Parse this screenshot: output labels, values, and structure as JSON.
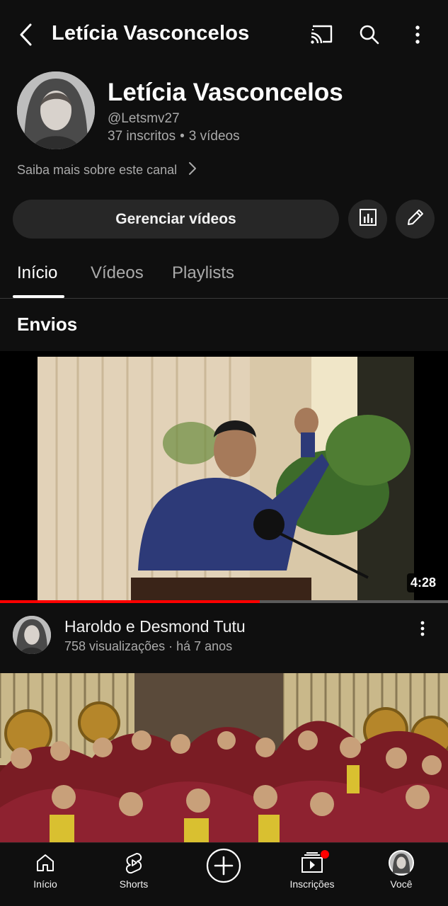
{
  "topbar": {
    "title": "Letícia Vasconcelos",
    "back_icon": "back-arrow-icon",
    "cast_icon": "cast-icon",
    "search_icon": "search-icon",
    "more_icon": "more-vertical-icon"
  },
  "channel": {
    "name": "Letícia Vasconcelos",
    "handle": "@Letsmv27",
    "subscribers": "37 inscritos",
    "separator": "•",
    "videos": "3 vídeos",
    "about_label": "Saiba mais sobre este canal"
  },
  "actions": {
    "manage_label": "Gerenciar vídeos",
    "analytics_icon": "analytics-icon",
    "edit_icon": "pencil-icon"
  },
  "tabs": [
    {
      "label": "Início",
      "active": true
    },
    {
      "label": "Vídeos",
      "active": false
    },
    {
      "label": "Playlists",
      "active": false
    }
  ],
  "section": {
    "title": "Envios"
  },
  "videos": [
    {
      "duration": "4:28",
      "watched_fraction": 0.58,
      "title": "Haroldo e Desmond Tutu",
      "subtitle": "758 visualizações · há 7 anos"
    }
  ],
  "bottom_nav": [
    {
      "label": "Início",
      "icon": "home-icon"
    },
    {
      "label": "Shorts",
      "icon": "shorts-icon"
    },
    {
      "label": "",
      "icon": "create-plus-icon"
    },
    {
      "label": "Inscrições",
      "icon": "subscriptions-icon",
      "has_badge": true
    },
    {
      "label": "Você",
      "icon": "profile-avatar-icon"
    }
  ],
  "colors": {
    "background": "#0f0f0f",
    "button_bg": "#272727",
    "accent_red": "#ff0000",
    "secondary_text": "#aaaaaa"
  }
}
